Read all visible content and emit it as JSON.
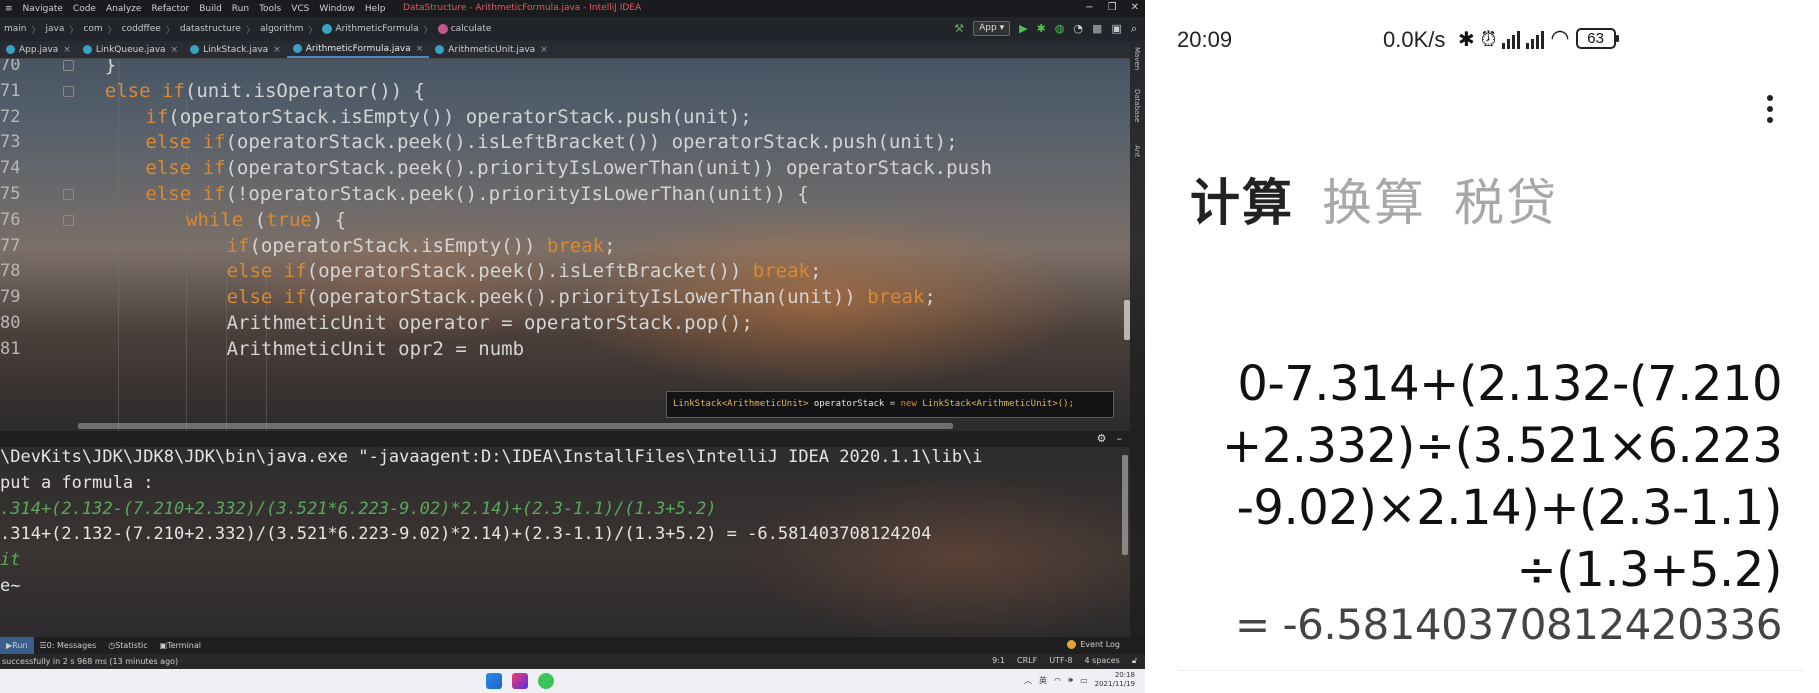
{
  "ide": {
    "window_title": "DataStructure - ArithmeticFormula.java - IntelliJ IDEA",
    "menu": [
      "≡",
      "Navigate",
      "Code",
      "Analyze",
      "Refactor",
      "Build",
      "Run",
      "Tools",
      "VCS",
      "Window",
      "Help"
    ],
    "window_controls": [
      "−",
      "❐",
      "✕"
    ],
    "breadcrumbs": [
      "main",
      "java",
      "com",
      "coddffee",
      "datastructure",
      "algorithm",
      "ArithmeticFormula",
      "calculate"
    ],
    "run_config": "App ▾",
    "tabs": [
      {
        "label": "App.java",
        "active": false
      },
      {
        "label": "LinkQueue.java",
        "active": false
      },
      {
        "label": "LinkStack.java",
        "active": false
      },
      {
        "label": "ArithmeticFormula.java",
        "active": true
      },
      {
        "label": "ArithmeticUnit.java",
        "active": false
      }
    ],
    "right_tools": [
      "Maven",
      "Database",
      "Ant"
    ],
    "code_lines": [
      {
        "num": "70",
        "indent": 3,
        "tokens": [
          {
            "t": "}",
            "c": "plain"
          }
        ]
      },
      {
        "num": "71",
        "indent": 3,
        "tokens": [
          {
            "t": "else if",
            "c": "kw"
          },
          {
            "t": "(unit.isOperator()) {",
            "c": "plain"
          }
        ]
      },
      {
        "num": "72",
        "indent": 4,
        "tokens": [
          {
            "t": "if",
            "c": "kw"
          },
          {
            "t": "(operatorStack.isEmpty()) operatorStack.push(unit);",
            "c": "plain"
          }
        ]
      },
      {
        "num": "73",
        "indent": 4,
        "tokens": [
          {
            "t": "else if",
            "c": "kw"
          },
          {
            "t": "(operatorStack.peek().isLeftBracket()) operatorStack.push(unit);",
            "c": "plain"
          }
        ]
      },
      {
        "num": "74",
        "indent": 4,
        "tokens": [
          {
            "t": "else if",
            "c": "kw"
          },
          {
            "t": "(operatorStack.peek().priorityIsLowerThan(unit)) operatorStack.push",
            "c": "plain"
          }
        ]
      },
      {
        "num": "75",
        "indent": 4,
        "tokens": [
          {
            "t": "else if",
            "c": "kw"
          },
          {
            "t": "(!operatorStack.peek().priorityIsLowerThan(unit)) {",
            "c": "plain"
          }
        ]
      },
      {
        "num": "76",
        "indent": 5,
        "tokens": [
          {
            "t": "while",
            "c": "kw"
          },
          {
            "t": " (",
            "c": "plain"
          },
          {
            "t": "true",
            "c": "kw"
          },
          {
            "t": ") {",
            "c": "plain"
          }
        ]
      },
      {
        "num": "77",
        "indent": 6,
        "tokens": [
          {
            "t": "if",
            "c": "kw"
          },
          {
            "t": "(operatorStack.isEmpty()) ",
            "c": "plain"
          },
          {
            "t": "break",
            "c": "kw"
          },
          {
            "t": ";",
            "c": "plain"
          }
        ]
      },
      {
        "num": "78",
        "indent": 6,
        "tokens": [
          {
            "t": "else if",
            "c": "kw"
          },
          {
            "t": "(operatorStack.peek().isLeftBracket()) ",
            "c": "plain"
          },
          {
            "t": "break",
            "c": "kw"
          },
          {
            "t": ";",
            "c": "plain"
          }
        ]
      },
      {
        "num": "79",
        "indent": 6,
        "tokens": [
          {
            "t": "else if",
            "c": "kw"
          },
          {
            "t": "(operatorStack.peek().priorityIsLowerThan(unit)) ",
            "c": "plain"
          },
          {
            "t": "break",
            "c": "kw"
          },
          {
            "t": ";",
            "c": "plain"
          }
        ]
      },
      {
        "num": "80",
        "indent": 6,
        "tokens": [
          {
            "t": "ArithmeticUnit operator = operatorStack.pop();",
            "c": "plain"
          }
        ]
      },
      {
        "num": "81",
        "indent": 6,
        "tokens": [
          {
            "t": "ArithmeticUnit opr2 = numb",
            "c": "plain"
          }
        ]
      }
    ],
    "tooltip": {
      "type": "LinkStack<ArithmeticUnit>",
      "var": "operatorStack",
      "eq": "=",
      "kw": "new",
      "ctor": "LinkStack<ArithmeticUnit>();"
    },
    "console_lines": [
      {
        "text": "\\DevKits\\JDK\\JDK8\\JDK\\bin\\java.exe \"-javaagent:D:\\IDEA\\InstallFiles\\IntelliJ IDEA 2020.1.1\\lib\\i",
        "style": "normal"
      },
      {
        "text": "put a formula :",
        "style": "normal"
      },
      {
        "text": ".314+(2.132-(7.210+2.332)/(3.521*6.223-9.02)*2.14)+(2.3-1.1)/(1.3+5.2)",
        "style": "input"
      },
      {
        "text": ".314+(2.132-(7.210+2.332)/(3.521*6.223-9.02)*2.14)+(2.3-1.1)/(1.3+5.2) = -6.581403708124204",
        "style": "normal"
      },
      {
        "text": "it",
        "style": "input"
      },
      {
        "text": "e~",
        "style": "normal"
      }
    ],
    "bottom_tools": [
      {
        "label": "Run",
        "active": true
      },
      {
        "label": "0: Messages",
        "active": false
      },
      {
        "label": "Statistic",
        "active": false
      },
      {
        "label": "Terminal",
        "active": false
      }
    ],
    "event_log": "Event Log",
    "status_message": "successfully in 2 s 968 ms (13 minutes ago)",
    "status_right": [
      "9:1",
      "CRLF",
      "UTF-8",
      "4 spaces"
    ],
    "tray": {
      "ime": "英",
      "time": "20:18",
      "date": "2021/11/19"
    }
  },
  "phone": {
    "time": "20:09",
    "net_speed": "0.0K/s",
    "battery": "63",
    "tabs": [
      {
        "label": "计算",
        "active": true
      },
      {
        "label": "换算",
        "active": false
      },
      {
        "label": "税贷",
        "active": false
      }
    ],
    "expression_lines": [
      "0-7.314+(2.132-(7.210",
      "+2.332)÷(3.521×6.223",
      "-9.02)×2.14)+(2.3-1.1)",
      "÷(1.3+5.2)"
    ],
    "result": "= -6.58140370812420336"
  }
}
